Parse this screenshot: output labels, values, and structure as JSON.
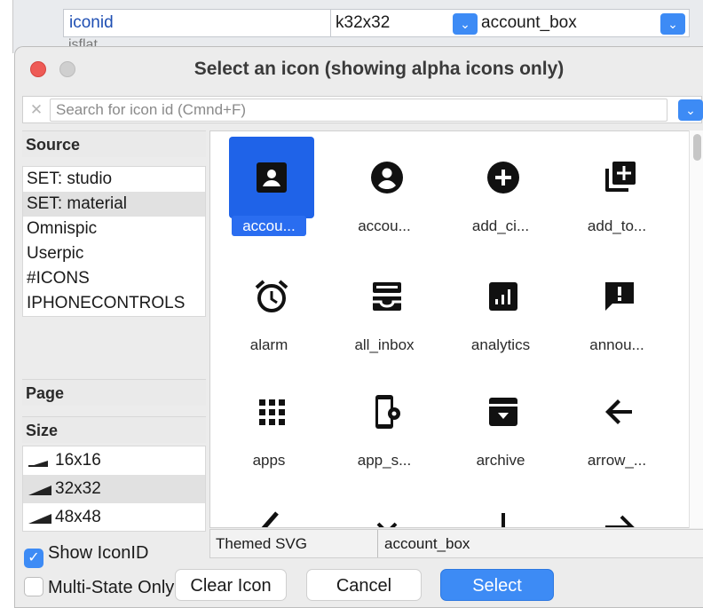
{
  "background_inspector": {
    "property_name": "iconid",
    "size_value": "k32x32",
    "icon_value": "account_box",
    "next_property_partial": "isflat"
  },
  "dialog": {
    "title": "Select an icon (showing alpha icons only)",
    "search": {
      "placeholder": "Search for icon id (Cmnd+F)",
      "value": ""
    },
    "source": {
      "header": "Source",
      "items": [
        "SET: studio",
        "SET: material",
        "Omnispic",
        "Userpic",
        "#ICONS",
        "IPHONECONTROLS"
      ],
      "selected": "SET: material"
    },
    "page": {
      "header": "Page"
    },
    "size": {
      "header": "Size",
      "items": [
        "16x16",
        "32x32",
        "48x48"
      ],
      "selected": "32x32"
    },
    "checkboxes": [
      {
        "label": "Show IconID",
        "checked": true
      },
      {
        "label": "Multi-State Only",
        "checked": false
      }
    ],
    "icons": [
      {
        "label": "accou...",
        "icon": "account-box-icon",
        "selected": true
      },
      {
        "label": "accou...",
        "icon": "account-circle-icon",
        "selected": false
      },
      {
        "label": "add_ci...",
        "icon": "add-circle-icon",
        "selected": false
      },
      {
        "label": "add_to...",
        "icon": "add-to-photos-icon",
        "selected": false
      },
      {
        "label": "alarm",
        "icon": "alarm-icon",
        "selected": false
      },
      {
        "label": "all_inbox",
        "icon": "all-inbox-icon",
        "selected": false
      },
      {
        "label": "analytics",
        "icon": "analytics-icon",
        "selected": false
      },
      {
        "label": "annou...",
        "icon": "announcement-icon",
        "selected": false
      },
      {
        "label": "apps",
        "icon": "apps-icon",
        "selected": false
      },
      {
        "label": "app_s...",
        "icon": "app-settings-icon",
        "selected": false
      },
      {
        "label": "archive",
        "icon": "archive-icon",
        "selected": false
      },
      {
        "label": "arrow_...",
        "icon": "arrow-back-icon",
        "selected": false
      },
      {
        "label": "",
        "icon": "arrow-back-ios-icon",
        "selected": false
      },
      {
        "label": "",
        "icon": "arrow-drop-down-icon",
        "selected": false
      },
      {
        "label": "",
        "icon": "arrow-downward-icon",
        "selected": false
      },
      {
        "label": "",
        "icon": "arrow-forward-icon",
        "selected": false
      }
    ],
    "status": {
      "icon_type": "Themed SVG",
      "icon_id": "account_box"
    },
    "buttons": {
      "clear": "Clear Icon",
      "cancel": "Cancel",
      "select": "Select"
    },
    "colors": {
      "accent": "#3d8bf5",
      "selection": "#1f63e8",
      "close": "#ee5b56"
    }
  }
}
